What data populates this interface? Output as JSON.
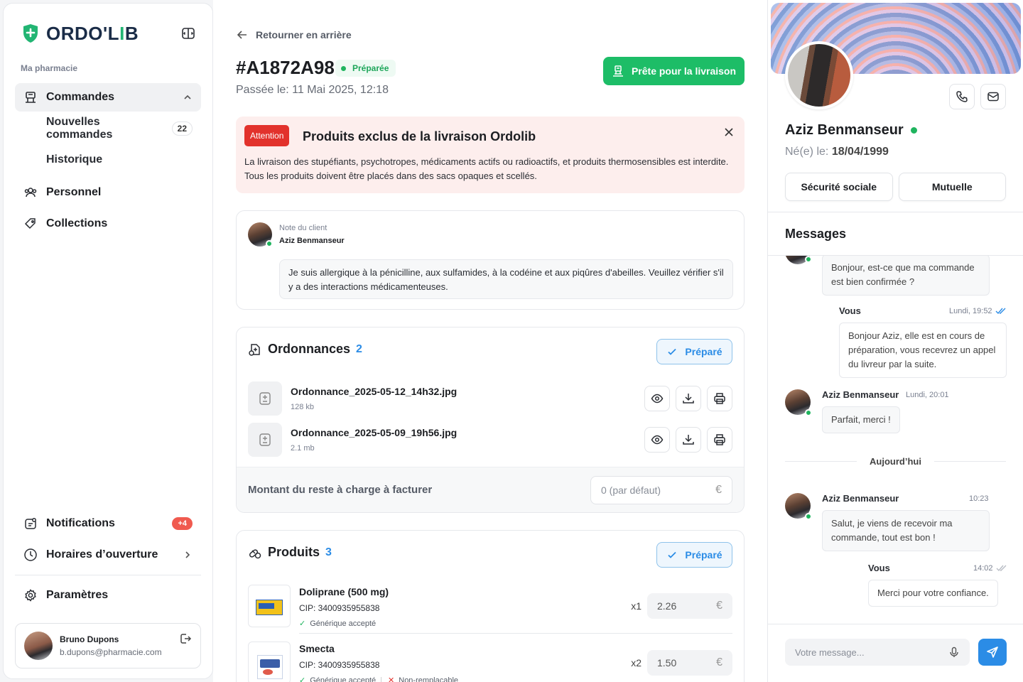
{
  "sidebar": {
    "logo_main": "ORDO'L",
    "logo_accent": "I",
    "logo_end": "B",
    "section_label": "Ma pharmacie",
    "nav": {
      "orders": "Commandes",
      "new_orders": "Nouvelles commandes",
      "new_orders_count": "22",
      "history": "Historique",
      "staff": "Personnel",
      "collections": "Collections"
    },
    "bottom": {
      "notifications": "Notifications",
      "notifications_badge": "+4",
      "hours": "Horaires d’ouverture",
      "settings": "Paramètres"
    },
    "user": {
      "name": "Bruno Dupons",
      "email": "b.dupons@pharmacie.com"
    }
  },
  "order": {
    "back": "Retourner en arrière",
    "id": "#A1872A98",
    "status": "Préparée",
    "date": "Passée le: 11 Mai 2025, 12:18",
    "ready_button": "Prête pour la livraison",
    "alert": {
      "tag": "Attention",
      "title": "Produits exclus de la livraison Ordolib",
      "body": "La livraison des stupéfiants, psychotropes, médicaments actifs ou radioactifs, et produits thermosensibles est interdite. Tous les produits doivent être placés dans des sacs opaques et scellés."
    },
    "note": {
      "label": "Note du client",
      "name": "Aziz Benmanseur",
      "text": "Je suis allergique à la pénicilline, aux sulfamides, à la codéine et aux piqûres d'abeilles. Veuillez vérifier s'il y a des interactions médicamenteuses."
    },
    "prescriptions": {
      "title": "Ordonnances",
      "count": "2",
      "prepared": "Préparé",
      "files": [
        {
          "name": "Ordonnance_2025-05-12_14h32.jpg",
          "size": "128 kb"
        },
        {
          "name": "Ordonnance_2025-05-09_19h56.jpg",
          "size": "2.1 mb"
        }
      ],
      "amount_label": "Montant du reste à charge à facturer",
      "amount_placeholder": "0 (par défaut)",
      "currency": "€"
    },
    "products": {
      "title": "Produits",
      "count": "3",
      "prepared": "Préparé",
      "items": [
        {
          "name": "Doliprane (500 mg)",
          "cip": "CIP: 3400935955838",
          "tag1": "Générique accepté",
          "tag2": "",
          "qty": "x1",
          "price": "2.26"
        },
        {
          "name": "Smecta",
          "cip": "CIP: 3400935955838",
          "tag1": "Générique accepté",
          "tag2": "Non-remplaçable",
          "qty": "x2",
          "price": "1.50"
        }
      ]
    }
  },
  "patient": {
    "name": "Aziz Benmanseur",
    "birth_label": "Né(e) le:",
    "birth_value": "18/04/1999",
    "btn_social": "Sécurité sociale",
    "btn_mutual": "Mutuelle",
    "messages_title": "Messages",
    "messages": {
      "m1": "Bonjour, est-ce que ma commande est bien confirmée ?",
      "m2_name": "Vous",
      "m2_time": "Lundi, 19:52",
      "m2": "Bonjour Aziz, elle est en cours de préparation, vous recevrez un appel du livreur par la suite.",
      "m3_name": "Aziz Benmanseur",
      "m3_time": "Lundi, 20:01",
      "m3": "Parfait, merci !",
      "day": "Aujourd’hui",
      "m4_name": "Aziz Benmanseur",
      "m4_time": "10:23",
      "m4": "Salut, je viens de recevoir ma commande, tout est bon !",
      "m5_name": "Vous",
      "m5_time": "14:02",
      "m5": "Merci pour votre confiance."
    },
    "composer_placeholder": "Votre message..."
  }
}
